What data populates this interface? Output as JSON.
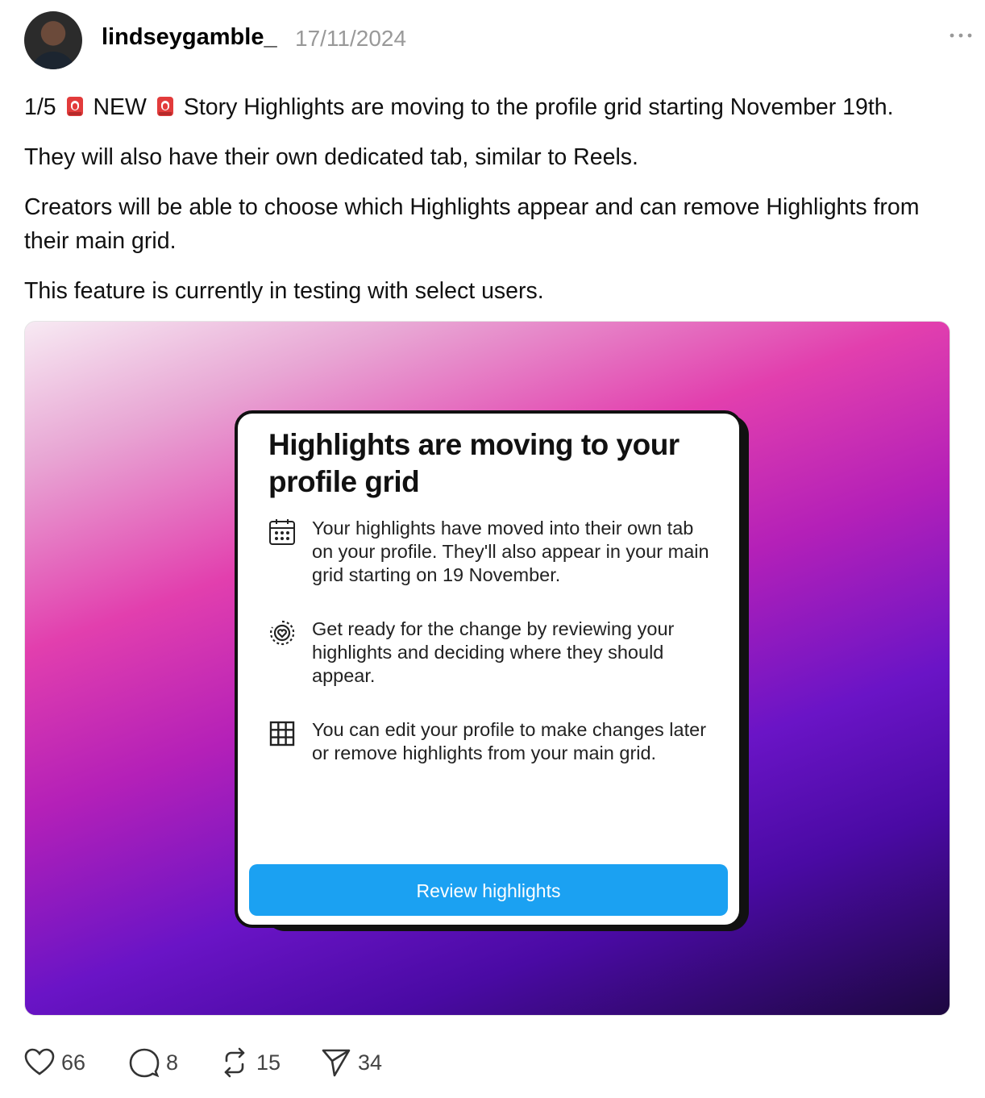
{
  "post": {
    "username": "lindseygamble_",
    "date": "17/11/2024",
    "paragraphs": {
      "p1_a": "1/5",
      "p1_b": "NEW",
      "p1_c": "Story Highlights are moving to the profile grid starting November 19th.",
      "p2": "They will also have their own dedicated tab, similar to Reels.",
      "p3": "Creators will be able to choose which Highlights appear and can remove Highlights from their main grid.",
      "p4": "This feature is currently in testing with select users."
    },
    "emoji_icon": "rotating-light-icon"
  },
  "media_card": {
    "title": "Highlights are moving to your profile grid",
    "items": [
      {
        "icon": "calendar-icon",
        "text": "Your highlights have moved into their own tab on your profile. They'll also appear in your main grid starting on 19 November."
      },
      {
        "icon": "highlight-heart-icon",
        "text": "Get ready for the change by reviewing your highlights and deciding where they should appear."
      },
      {
        "icon": "grid-icon",
        "text": "You can edit your profile to make changes later or remove highlights from your main grid."
      }
    ],
    "button_label": "Review highlights",
    "colors": {
      "button": "#1ba1f2",
      "gradient_start": "#f7eaf3",
      "gradient_mid": "#e23fae",
      "gradient_end": "#1d0840"
    }
  },
  "actions": {
    "likes": "66",
    "replies": "8",
    "reposts": "15",
    "shares": "34"
  }
}
